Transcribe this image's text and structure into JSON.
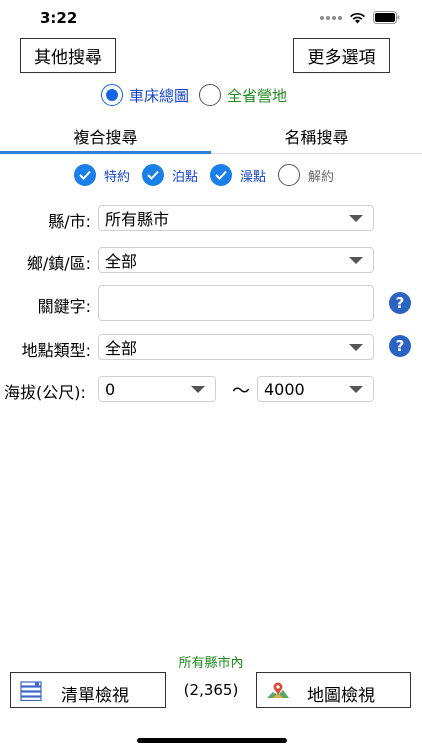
{
  "status_bar": {
    "time": "3:22"
  },
  "header": {
    "other_search": "其他搜尋",
    "more_options": "更多選項"
  },
  "scope": {
    "options": [
      {
        "label": "車床總圖",
        "selected": true
      },
      {
        "label": "全省營地",
        "selected": false
      }
    ]
  },
  "tabs": [
    {
      "label": "複合搜尋",
      "active": true
    },
    {
      "label": "名稱搜尋",
      "active": false
    }
  ],
  "filters": [
    {
      "label": "特約",
      "checked": true
    },
    {
      "label": "泊點",
      "checked": true
    },
    {
      "label": "澡點",
      "checked": true
    },
    {
      "label": "解約",
      "checked": false
    }
  ],
  "form": {
    "county_label": "縣/市:",
    "county_value": "所有縣市",
    "township_label": "鄉/鎮/區:",
    "township_value": "全部",
    "keyword_label": "關鍵字:",
    "keyword_value": "",
    "place_type_label": "地點類型:",
    "place_type_value": "全部",
    "altitude_label": "海拔(公尺):",
    "altitude_min": "0",
    "altitude_sep": "～",
    "altitude_max": "4000"
  },
  "footer": {
    "scope_note": "所有縣市內",
    "list_view": "清單檢視",
    "count": "(2,365)",
    "map_view": "地圖檢視"
  },
  "colors": {
    "accent_blue": "#1a7fe8",
    "scope_green": "#1f8a1f",
    "help_blue": "#2a63c4"
  }
}
